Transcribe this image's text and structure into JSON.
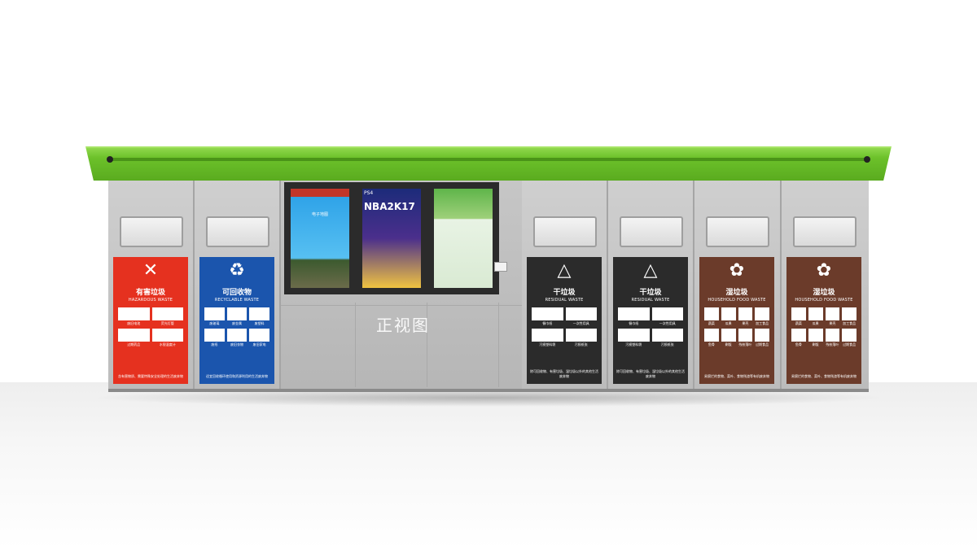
{
  "caption": "正视图",
  "colors": {
    "roof": "#6cc12a",
    "hazardous": "#e5311f",
    "recyclable": "#1b55ad",
    "residual": "#2b2b2b",
    "food": "#6b3b2a"
  },
  "screens": [
    {
      "name": "menu-screen",
      "label": "电子地图"
    },
    {
      "name": "game-screen",
      "brand": "PS4",
      "title": "NBA2K17"
    },
    {
      "name": "guide-screen"
    }
  ],
  "bins": [
    {
      "name": "hazardous",
      "title_cn": "有害垃圾",
      "title_en": "HAZARDOUS WASTE",
      "icon": "hazard-x-icon",
      "items": [
        "废旧电池",
        "荧光灯管",
        "过期药品",
        "水银温度计"
      ],
      "foot": "含有害物质、需要特殊安全处理的生活废弃物"
    },
    {
      "name": "recyclable",
      "title_cn": "可回收物",
      "title_en": "RECYCLABLE WASTE",
      "icon": "recycle-icon",
      "items": [
        "废玻璃",
        "废金属",
        "废塑料",
        "废纸",
        "废旧衣物",
        "废旧家电"
      ],
      "foot": "适宜回收循环使用和资源利用的生活废弃物"
    },
    {
      "name": "residual-1",
      "title_cn": "干垃圾",
      "title_en": "RESIDUAL WASTE",
      "icon": "residual-arrows-icon",
      "items": [
        "餐巾纸",
        "一次性用具",
        "污损塑料袋",
        "污损纸张"
      ],
      "foot": "除可回收物、有害垃圾、湿垃圾以外的其他生活废弃物"
    },
    {
      "name": "residual-2",
      "title_cn": "干垃圾",
      "title_en": "RESIDUAL WASTE",
      "icon": "residual-arrows-icon",
      "items": [
        "餐巾纸",
        "一次性用具",
        "污损塑料袋",
        "污损纸张"
      ],
      "foot": "除可回收物、有害垃圾、湿垃圾以外的其他生活废弃物"
    },
    {
      "name": "food-1",
      "title_cn": "湿垃圾",
      "title_en": "HOUSEHOLD FOOD WASTE",
      "icon": "food-waste-icon",
      "items": [
        "蔬菜",
        "瓜果",
        "果壳",
        "加工食品",
        "鱼骨",
        "剩饭",
        "残枝落叶",
        "过期食品"
      ],
      "foot": "易腐烂的食物、菜叶、食物残渣等有机废弃物"
    },
    {
      "name": "food-2",
      "title_cn": "湿垃圾",
      "title_en": "HOUSEHOLD FOOD WASTE",
      "icon": "food-waste-icon",
      "items": [
        "蔬菜",
        "瓜果",
        "果壳",
        "加工食品",
        "鱼骨",
        "剩饭",
        "残枝落叶",
        "过期食品"
      ],
      "foot": "易腐烂的食物、菜叶、食物残渣等有机废弃物"
    }
  ]
}
